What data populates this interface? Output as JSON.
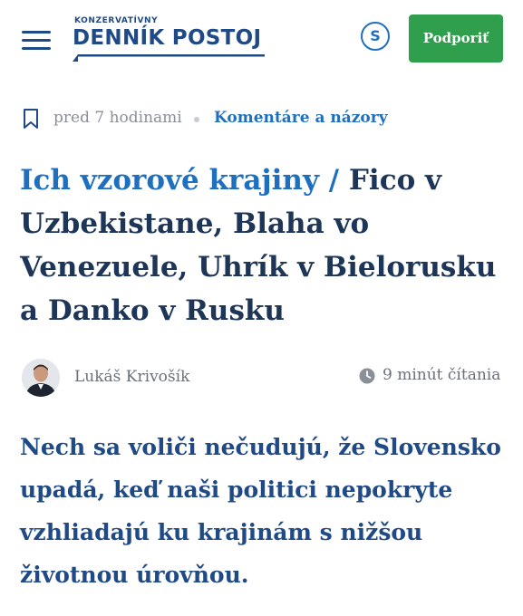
{
  "header": {
    "logo_small": "KONZERVATÍVNY",
    "logo_main": "DENNÍK POSTOJ",
    "s_badge": "S",
    "support_label": "Podporiť"
  },
  "colors": {
    "brand_blue": "#1f4a86",
    "link_blue": "#1f6fbf",
    "support_green": "#2f9e4d"
  },
  "meta": {
    "time": "pred 7 hodinami",
    "category": "Komentáre a názory"
  },
  "article": {
    "kicker": "Ich vzorové krajiny /",
    "title": "Fico v Uzbekistane, Blaha vo Venezuele, Uhrík v Bielorusku a Danko v Rusku",
    "author": "Lukáš Krivošík",
    "read_time": "9 minút čítania",
    "lead": "Nech sa voliči nečudujú, že Slovensko upadá, keď naši politici nepokryte vzhliadajú ku krajinám s nižšou životnou úrovňou."
  },
  "icons": [
    "menu-icon",
    "s-icon",
    "bookmark-icon",
    "clock-icon"
  ]
}
